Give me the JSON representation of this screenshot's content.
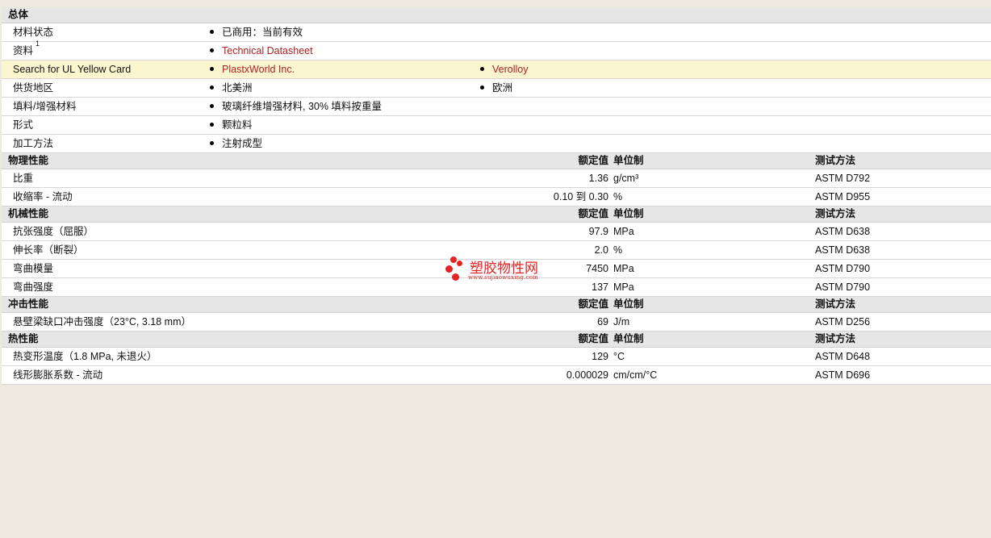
{
  "general": {
    "section_title": "总体",
    "rows": [
      {
        "label": "材料状态",
        "values": [
          "已商用：当前有效"
        ]
      },
      {
        "label": "资料",
        "sup": "1",
        "values": [
          "Technical Datasheet"
        ]
      },
      {
        "label": "Search for UL Yellow Card",
        "values": [
          "PlastxWorld Inc.",
          "Verolloy"
        ]
      },
      {
        "label": "供货地区",
        "values": [
          "北美洲",
          "欧洲"
        ]
      },
      {
        "label": "填料/增强材料",
        "values": [
          "玻璃纤维增强材料, 30% 填料按重量"
        ]
      },
      {
        "label": "形式",
        "values": [
          "颗粒料"
        ]
      },
      {
        "label": "加工方法",
        "values": [
          "注射成型"
        ]
      }
    ]
  },
  "headers": {
    "nominal": "额定值",
    "unit": "单位制",
    "test": "测试方法"
  },
  "physical": {
    "section_title": "物理性能",
    "rows": [
      {
        "label": "比重",
        "value": "1.36",
        "unit": "g/cm³",
        "test": "ASTM D792"
      },
      {
        "label": "收缩率  - 流动",
        "value": "0.10 到  0.30",
        "unit": "%",
        "test": "ASTM D955"
      }
    ]
  },
  "mechanical": {
    "section_title": "机械性能",
    "rows": [
      {
        "label": "抗张强度（屈服）",
        "value": "97.9",
        "unit": "MPa",
        "test": "ASTM D638"
      },
      {
        "label": "伸长率（断裂）",
        "value": "2.0",
        "unit": "%",
        "test": "ASTM D638"
      },
      {
        "label": "弯曲模量",
        "value": "7450",
        "unit": "MPa",
        "test": "ASTM D790"
      },
      {
        "label": "弯曲强度",
        "value": "137",
        "unit": "MPa",
        "test": "ASTM D790"
      }
    ]
  },
  "impact": {
    "section_title": "冲击性能",
    "rows": [
      {
        "label": "悬壁梁缺口冲击强度（23°C, 3.18 mm）",
        "value": "69",
        "unit": "J/m",
        "test": "ASTM D256"
      }
    ]
  },
  "thermal": {
    "section_title": "热性能",
    "rows": [
      {
        "label": "热变形温度（1.8 MPa, 未退火）",
        "value": "129",
        "unit": "°C",
        "test": "ASTM D648"
      },
      {
        "label": "线形膨胀系数  - 流动",
        "value": "0.000029",
        "unit": "cm/cm/°C",
        "test": "ASTM D696"
      }
    ]
  },
  "watermark": {
    "name": "塑胶物性网",
    "url": "www.sujiaowuxing.com",
    "color": "#E52222"
  },
  "colors": {
    "link": "#B02020",
    "highlight": "#FBF6CF",
    "section_bg": "#E6E6E6",
    "page_bg": "#ECE9DF"
  }
}
